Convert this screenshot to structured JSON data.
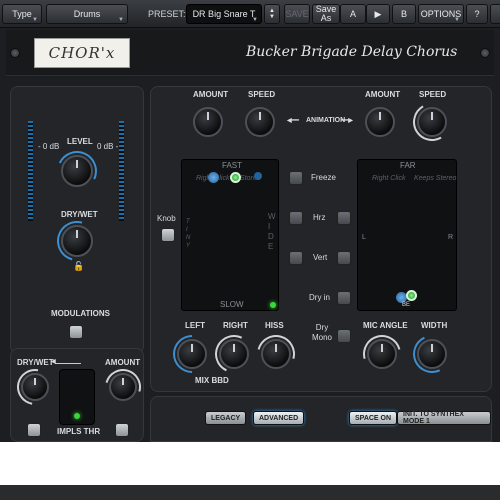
{
  "toolbar": {
    "type_label": "Type",
    "bank_value": "Drums",
    "preset_label": "PRESET:",
    "preset_value": "DR Big Snare T",
    "save_label": "SAVE",
    "save_as_label": "Save As",
    "a_label": "A",
    "arrow_label": "▶",
    "b_label": "B",
    "options_label": "OPTIONS",
    "help_label": "?"
  },
  "header": {
    "logo_text": "CHOR'x",
    "title": "Bucker Brigade Delay Chorus"
  },
  "left_panel": {
    "level_label": "LEVEL",
    "left_db": "- 0 dB",
    "right_db": "0 dB -",
    "drywet_label": "DRY/WET",
    "modulations_label": "MODULATIONS"
  },
  "bottom_left": {
    "drywet_label": "DRY/WET",
    "amount_label": "AMOUNT",
    "impls_label": "IMPLS THR"
  },
  "main": {
    "amount_left_label": "AMOUNT",
    "speed_left_label": "SPEED",
    "animation_label": "ANIMATION",
    "amount_right_label": "AMOUNT",
    "speed_right_label": "SPEED",
    "knob_label": "Knob",
    "xy_left": {
      "top": "FAST",
      "bottom": "SLOW",
      "hint_left": "Right Click",
      "hint_right": "Stores",
      "side_left": "T I N Y",
      "side_right": "W I D E"
    },
    "xy_right": {
      "top": "FAR",
      "hint_left": "Right Click",
      "hint_right": "Keeps Stereo",
      "side_left": "L",
      "side_right": "R",
      "bottom_marker": "BE"
    },
    "center_buttons": [
      "Freeze",
      "Hrz",
      "Vert",
      "Dry in",
      "Dry Mono"
    ],
    "left_label": "LEFT",
    "right_label": "RIGHT",
    "hiss_label": "HISS",
    "mix_bbd_label": "MIX BBD",
    "mic_angle_label": "MIC ANGLE",
    "width_label": "WIDTH",
    "legacy_label": "LEGACY",
    "advanced_label": "ADVANCED",
    "space_on_label": "SPACE ON",
    "init_label": "INIT. TO SYNTHEX MODE 1"
  },
  "colors": {
    "accent_blue": "#3c8fd0",
    "led_green": "#39d63c",
    "panel": "#232528",
    "background": "#1c1e21"
  }
}
